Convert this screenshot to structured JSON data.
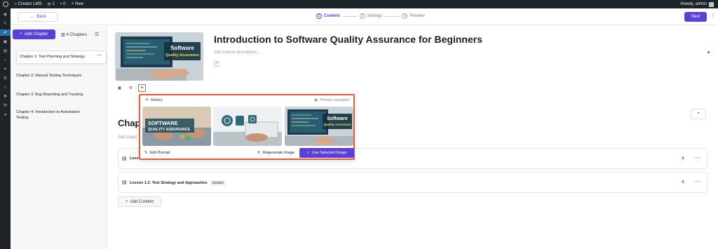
{
  "admin_bar": {
    "site_name": "Creator LMS",
    "updates_count": "1",
    "comments_count": "0",
    "new_label": "New",
    "greeting": "Howdy, admin"
  },
  "topbar": {
    "back_label": "Back",
    "steps": [
      {
        "num": "1",
        "label": "Content",
        "active": true
      },
      {
        "num": "2",
        "label": "Settings",
        "active": false
      },
      {
        "num": "3",
        "label": "Preview",
        "active": false
      }
    ],
    "next_label": "Next"
  },
  "sidebar": {
    "add_chapter_label": "Add Chapter",
    "chapter_count": "4 Chapters",
    "chapters": [
      "Chapter 1: Test Planning and Strategy",
      "Chapter 2: Manual Testing Techniques",
      "Chapter 3: Bug Reporting and Tracking",
      "Chapter 4: Introduction to Automation Testing"
    ]
  },
  "course": {
    "title": "Introduction to Software Quality Assurance for Beginners",
    "description_placeholder": "Add course description ...",
    "thumbnail_text_1": "Software",
    "thumbnail_text_2": "Quality Assurance"
  },
  "chapter": {
    "heading": "Chapt",
    "subtext": "Add chapt"
  },
  "lessons": [
    {
      "name": "Less",
      "tag": ""
    },
    {
      "name": "Lesson 1.2: Test Strategy and Approaches",
      "tag": "Lesson"
    }
  ],
  "add_content_label": "Add Content",
  "ai_popup": {
    "history_label": "History",
    "prompt_examples_label": "Prompt examples",
    "image_1_text_1": "SOFTWARE",
    "image_1_text_2": "QUALITY ASSURANCE",
    "image_3_text_1": "Software",
    "image_3_text_2": "Quality Assurance",
    "edit_prompt_label": "Edit Prompt",
    "regenerate_label": "Regenerate Image",
    "use_selected_label": "Use Selected Image"
  },
  "colors": {
    "accent": "#5b3fd6",
    "highlight": "#e35d3a",
    "wp_bar": "#1d2327"
  }
}
